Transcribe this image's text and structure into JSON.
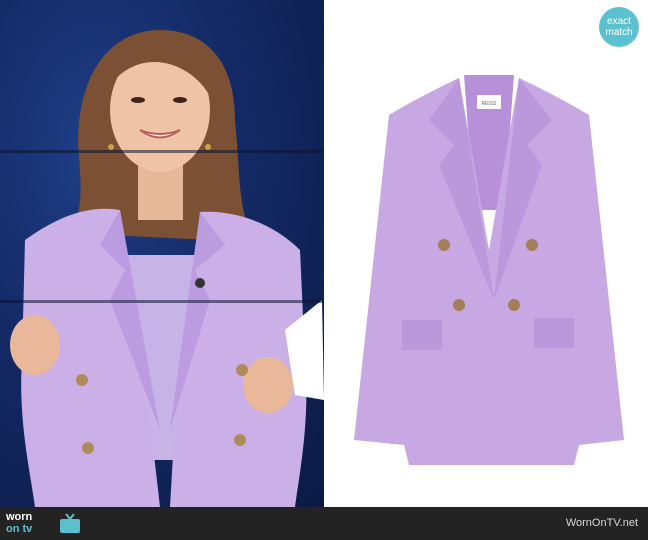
{
  "badge": {
    "line1": "exact",
    "line2": "match"
  },
  "footer": {
    "logo_top": "worn",
    "logo_bottom": "on tv",
    "site": "WornOnTV.net"
  },
  "product": {
    "label_text": "REISS"
  },
  "colors": {
    "badge": "#5cc1cf",
    "blazer": "#c7a8e3",
    "footer_bg": "#232323",
    "studio_bg": "#142a66"
  },
  "icons": [
    "tv-icon"
  ]
}
